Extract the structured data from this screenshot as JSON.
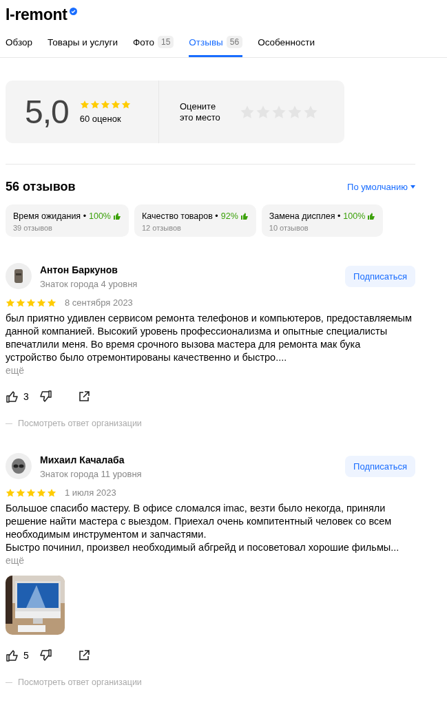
{
  "title": "I-remont",
  "verified": true,
  "tabs": [
    {
      "label": "Обзор",
      "selected": false
    },
    {
      "label": "Товары и услуги",
      "selected": false
    },
    {
      "label": "Фото",
      "count": "15",
      "selected": false
    },
    {
      "label": "Отзывы",
      "count": "56",
      "selected": true
    },
    {
      "label": "Особенности",
      "selected": false
    }
  ],
  "rating": {
    "score": "5,0",
    "stars": 5,
    "count": "60 оценок",
    "rate_prompt": "Оцените\nэто место"
  },
  "reviews_heading": "56 отзывов",
  "sort": "По умолчанию",
  "aspects": [
    {
      "name": "Время ожидания",
      "bullet": "•",
      "percent": "100%",
      "count": "39 отзывов"
    },
    {
      "name": "Качество товаров",
      "bullet": "•",
      "percent": "92%",
      "count": "12 отзывов"
    },
    {
      "name": "Замена дисплея",
      "bullet": "•",
      "percent": "100%",
      "count": "10 отзывов"
    }
  ],
  "reviews": [
    {
      "author": "Антон Баркунов",
      "level": "Знаток города 4 уровня",
      "subscribe": "Подписаться",
      "stars": 5,
      "date": "8 сентября 2023",
      "text": "был приятно удивлен сервисом ремонта телефонов и компьютеров, предоставляемым данной компанией. Высокий уровень профессионализма и опытные специалисты впечатлили меня. Во время срочного вызова мастера для ремонта мак бука устройство было отремонтированы качественно и быстро....",
      "more": "ещё",
      "likes": "3",
      "reply": "Посмотреть ответ организации"
    },
    {
      "author": "Михаил Качалаба",
      "level": "Знаток города 11 уровня",
      "subscribe": "Подписаться",
      "stars": 5,
      "date": "1 июля 2023",
      "text": "Большое спасибо мастеру. В офисе сломался imac, везти было некогда, приняли решение найти мастера с выездом. Приехал очень компитентный человек со всем необходимым инструментом и запчастями.\nБыстро починил, произвел необходимый абгрейд и посоветовал хорошие фильмы...",
      "more": "ещё",
      "photos": [
        {
          "kind": "picture"
        }
      ],
      "likes": "5",
      "reply": "Посмотреть ответ организации"
    }
  ]
}
